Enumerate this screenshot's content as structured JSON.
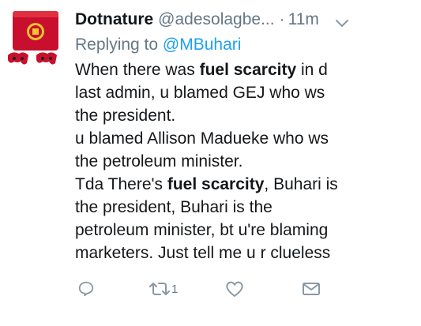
{
  "tweet": {
    "author_name": "Dotnature",
    "author_handle": "@adesolagbe...",
    "separator": "·",
    "time": "11m",
    "replying_prefix": "Replying to",
    "replying_to": "@MBuhari",
    "lines": [
      [
        {
          "t": "When there was ",
          "b": false
        },
        {
          "t": "fuel scarcity",
          "b": true
        },
        {
          "t": " in d",
          "b": false
        }
      ],
      [
        {
          "t": "last admin, u blamed GEJ who ws",
          "b": false
        }
      ],
      [
        {
          "t": "the president.",
          "b": false
        }
      ],
      [
        {
          "t": "u blamed Allison Madueke who ws",
          "b": false
        }
      ],
      [
        {
          "t": "the petroleum minister.",
          "b": false
        }
      ],
      [
        {
          "t": "Tda There's ",
          "b": false
        },
        {
          "t": "fuel scarcity",
          "b": true
        },
        {
          "t": ", Buhari is",
          "b": false
        }
      ],
      [
        {
          "t": "the president, Buhari is the",
          "b": false
        }
      ],
      [
        {
          "t": "petroleum minister, bt u're blaming",
          "b": false
        }
      ],
      [
        {
          "t": "marketers. Just tell me u r clueless",
          "b": false
        }
      ]
    ],
    "retweet_count": "1"
  },
  "icons": {
    "avatar": "manchester-united-console-avatar",
    "caret": "chevron-down-icon",
    "reply": "reply-icon",
    "retweet": "retweet-icon",
    "like": "heart-icon",
    "dm": "envelope-icon"
  },
  "colors": {
    "text": "#14171a",
    "muted": "#657786",
    "icon": "#8899a6",
    "link": "#1da1f2"
  }
}
